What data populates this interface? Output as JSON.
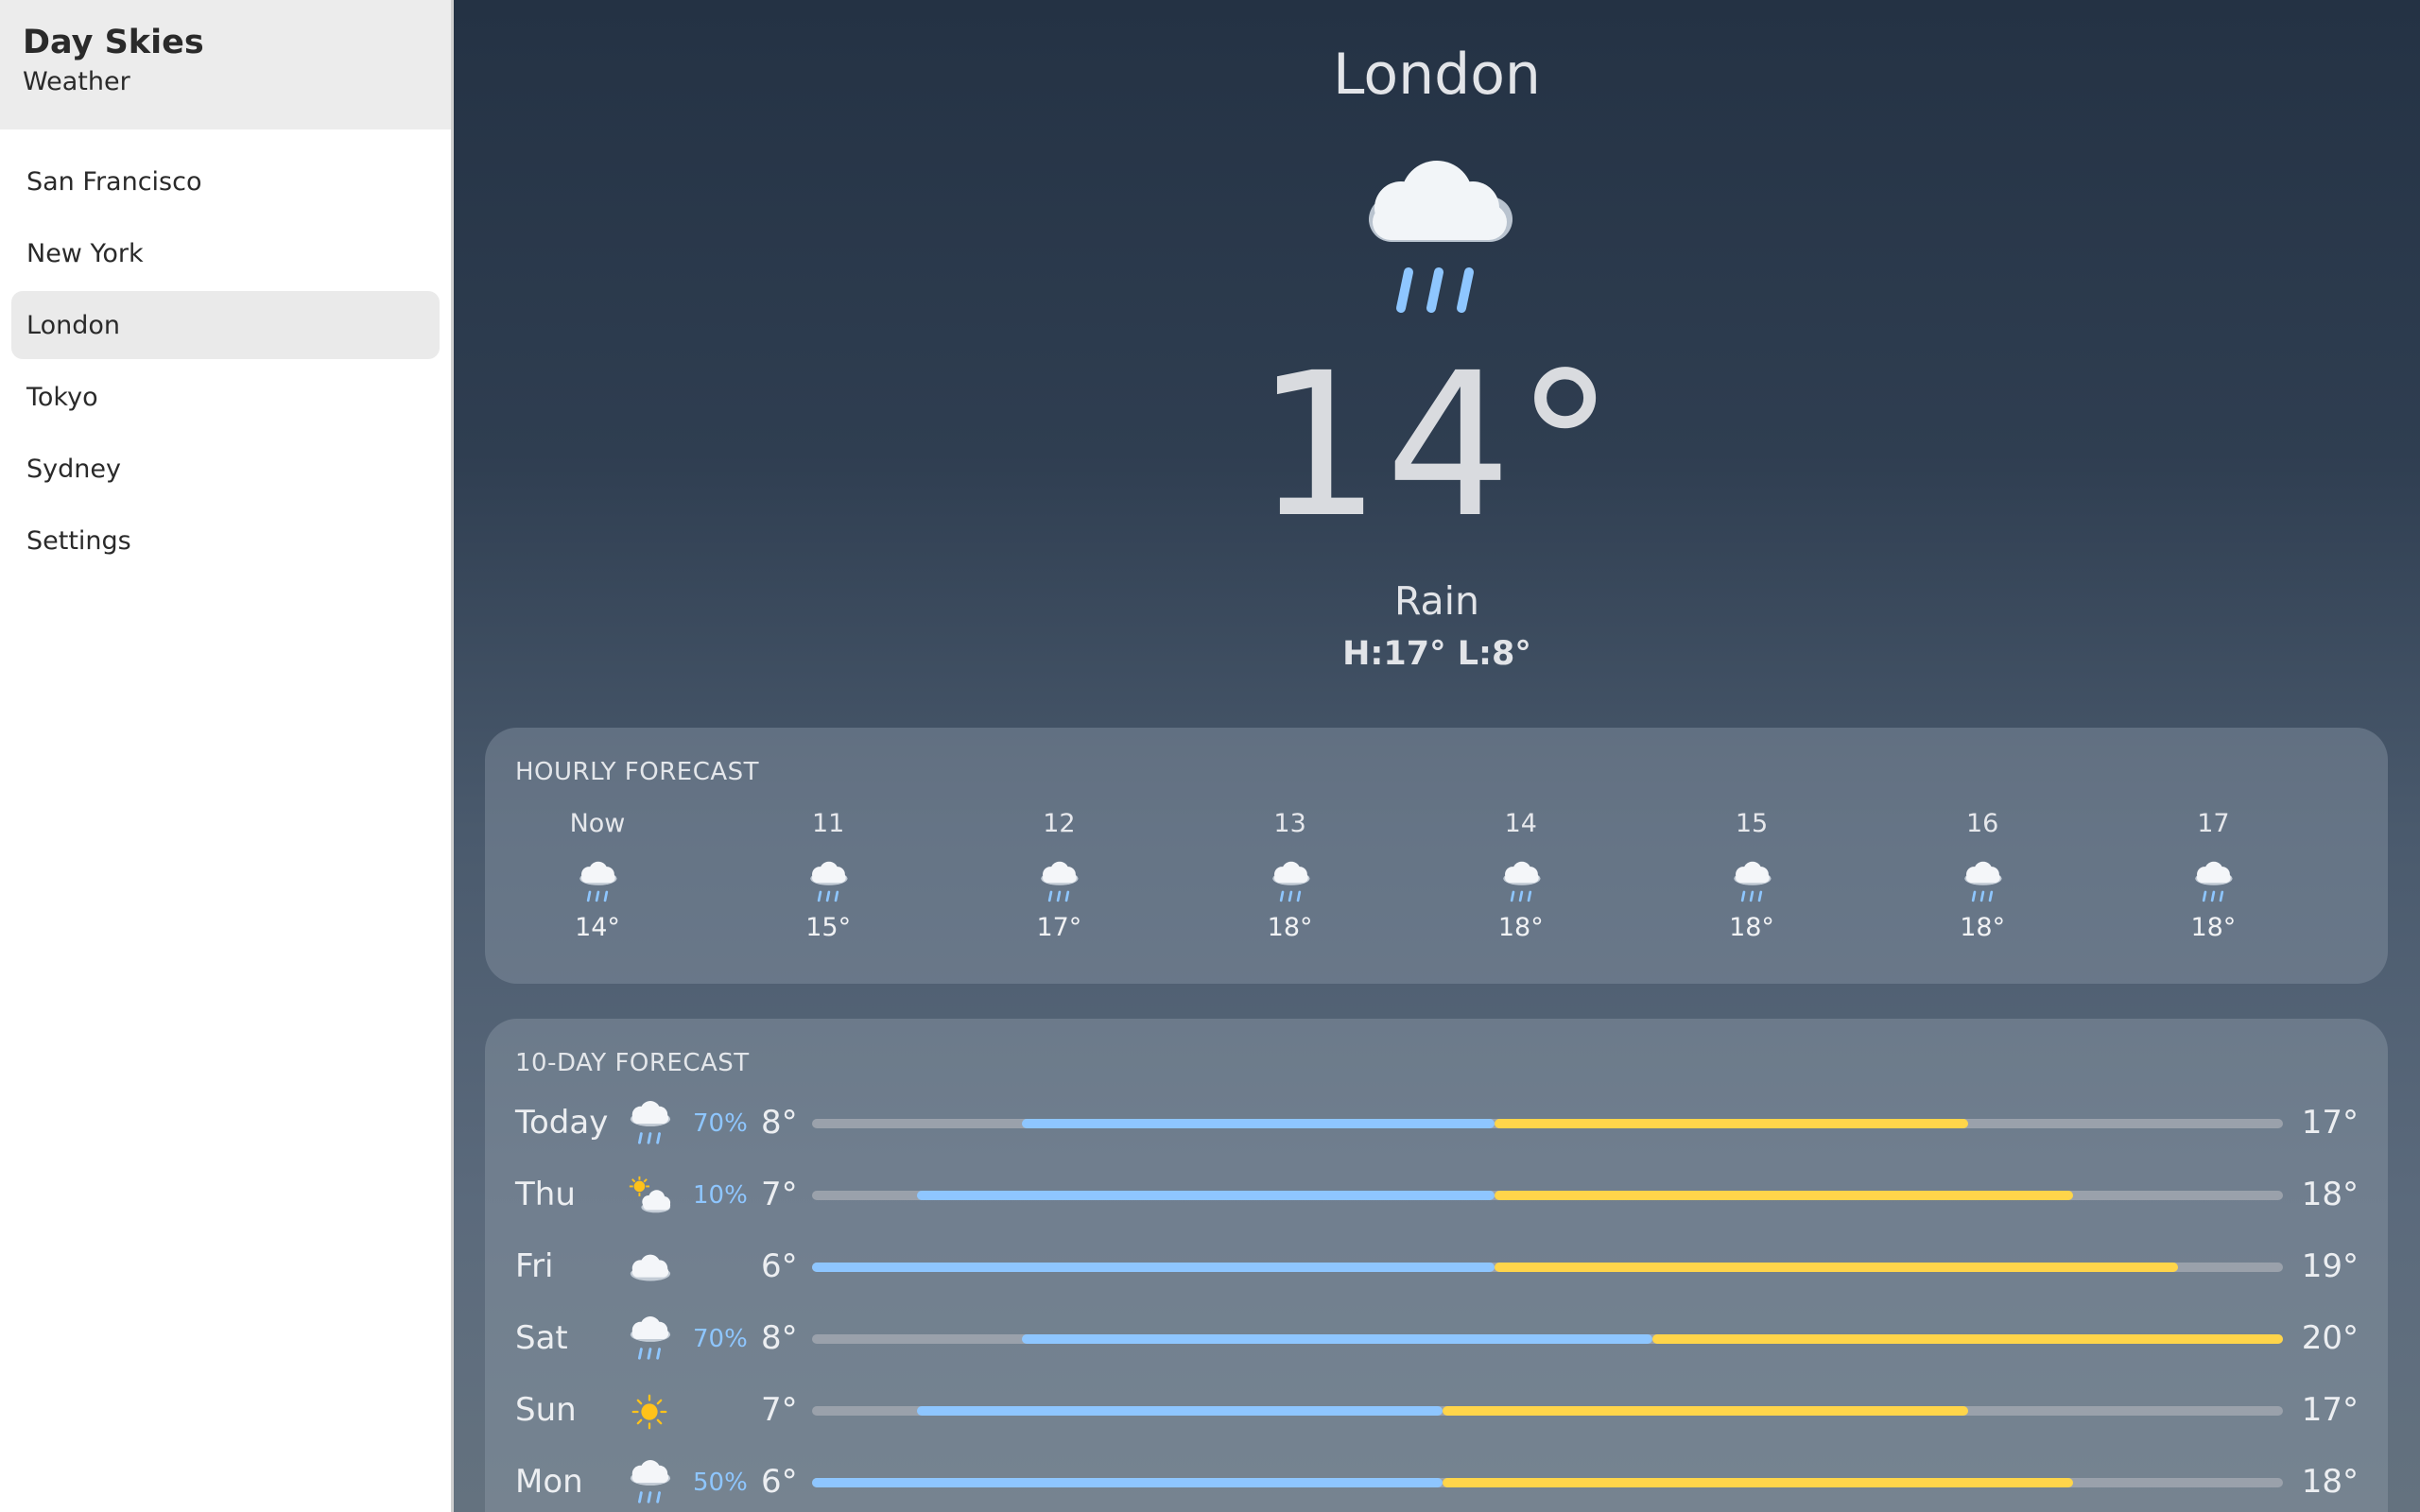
{
  "app": {
    "title": "Day Skies",
    "subtitle": "Weather"
  },
  "sidebar": {
    "items": [
      {
        "label": "San Francisco",
        "active": false
      },
      {
        "label": "New York",
        "active": false
      },
      {
        "label": "London",
        "active": true
      },
      {
        "label": "Tokyo",
        "active": false
      },
      {
        "label": "Sydney",
        "active": false
      },
      {
        "label": "Settings",
        "active": false
      }
    ]
  },
  "current": {
    "city": "London",
    "icon": "rain-icon",
    "temperature": "14°",
    "condition": "Rain",
    "hilo": "H:17° L:8°"
  },
  "hourly": {
    "title": "HOURLY FORECAST",
    "items": [
      {
        "time": "Now",
        "icon": "rain-icon",
        "temp": "14°"
      },
      {
        "time": "11",
        "icon": "rain-icon",
        "temp": "15°"
      },
      {
        "time": "12",
        "icon": "rain-icon",
        "temp": "17°"
      },
      {
        "time": "13",
        "icon": "rain-icon",
        "temp": "18°"
      },
      {
        "time": "14",
        "icon": "rain-icon",
        "temp": "18°"
      },
      {
        "time": "15",
        "icon": "rain-icon",
        "temp": "18°"
      },
      {
        "time": "16",
        "icon": "rain-icon",
        "temp": "18°"
      },
      {
        "time": "17",
        "icon": "rain-icon",
        "temp": "18°"
      }
    ]
  },
  "daily": {
    "title": "10-DAY FORECAST",
    "range_min": 6,
    "range_max": 20,
    "days": [
      {
        "day": "Today",
        "icon": "rain-icon",
        "precip": "70%",
        "low": "8°",
        "high": "17°",
        "low_val": 8,
        "high_val": 17
      },
      {
        "day": "Thu",
        "icon": "partly-cloudy-icon",
        "precip": "10%",
        "low": "7°",
        "high": "18°",
        "low_val": 7,
        "high_val": 18
      },
      {
        "day": "Fri",
        "icon": "cloud-icon",
        "precip": "",
        "low": "6°",
        "high": "19°",
        "low_val": 6,
        "high_val": 19
      },
      {
        "day": "Sat",
        "icon": "rain-icon",
        "precip": "70%",
        "low": "8°",
        "high": "20°",
        "low_val": 8,
        "high_val": 20
      },
      {
        "day": "Sun",
        "icon": "sun-icon",
        "precip": "",
        "low": "7°",
        "high": "17°",
        "low_val": 7,
        "high_val": 17
      },
      {
        "day": "Mon",
        "icon": "rain-icon",
        "precip": "50%",
        "low": "6°",
        "high": "18°",
        "low_val": 6,
        "high_val": 18
      }
    ]
  },
  "colors": {
    "bar_cold": "#8ec6ff",
    "bar_warm": "#ffd54a",
    "precip": "#8ec6ff"
  }
}
